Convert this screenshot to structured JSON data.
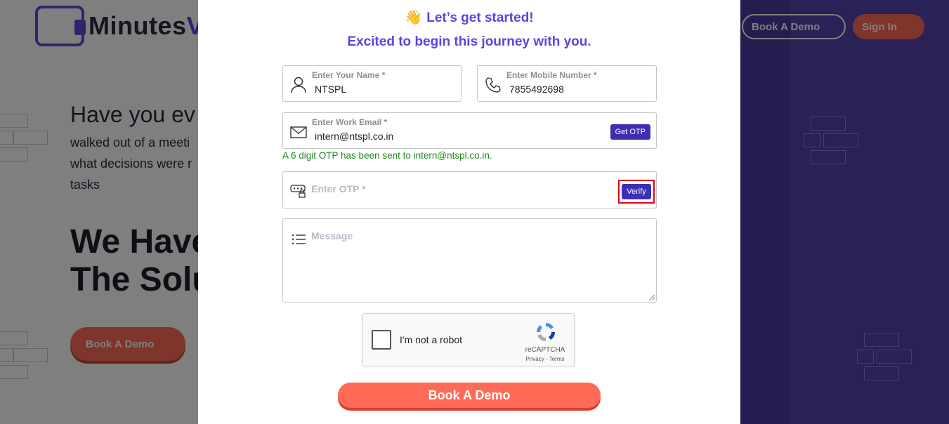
{
  "background": {
    "logo_text": "Minutes",
    "logo_text_accent": "V",
    "headline_partial": "Have you ev",
    "paragraph_lines": [
      "walked out of a meeti",
      "what decisions were r",
      "tasks"
    ],
    "hero_line1": "We Have",
    "hero_line2": "The Solu",
    "hero_button": "Book A Demo",
    "nav_book_demo": "Book A Demo",
    "nav_sign_in": "Sign In"
  },
  "modal": {
    "title_icon": "waving-hand-icon",
    "title": "Let’s get started!",
    "subtitle": "Excited to begin this journey with you.",
    "name_field": {
      "label": "Enter Your Name *",
      "value": "NTSPL",
      "icon": "user-icon"
    },
    "mobile_field": {
      "label": "Enter Mobile Number *",
      "value": "7855492698",
      "icon": "phone-icon"
    },
    "email_field": {
      "label": "Enter Work Email *",
      "value": "intern@ntspl.co.in",
      "icon": "envelope-icon",
      "button": "Get OTP"
    },
    "otp_message": "A 6 digit OTP has been sent to intern@ntspl.co.in.",
    "otp_field": {
      "placeholder": "Enter OTP *",
      "icon": "password-lock-icon",
      "button": "Verify"
    },
    "message_field": {
      "placeholder": "Message",
      "icon": "list-icon"
    },
    "captcha": {
      "label": "I'm not a robot",
      "brand": "reCAPTCHA",
      "terms": "Privacy - Terms"
    },
    "submit": "Book A Demo"
  },
  "colors": {
    "accent": "#5c44dd",
    "button_dark": "#3d2fb3",
    "cta": "#ff6b57",
    "success": "#1d8a1d",
    "highlight": "#e0001b"
  }
}
